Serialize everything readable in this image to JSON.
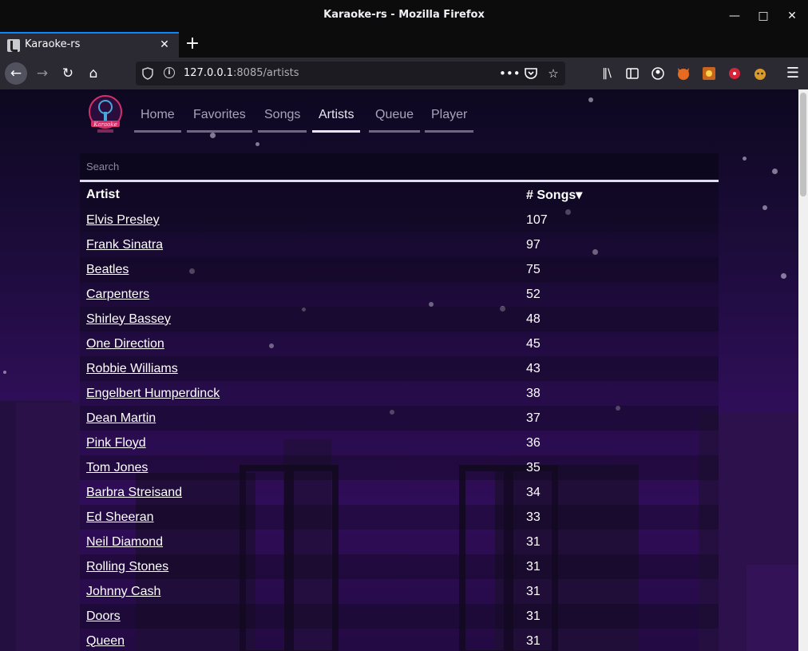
{
  "window": {
    "title": "Karaoke-rs - Mozilla Firefox"
  },
  "tab": {
    "label": "Karaoke-rs"
  },
  "url": {
    "host": "127.0.0.1",
    "rest": ":8085/artists"
  },
  "nav": {
    "logo_text": "Karaoke",
    "links": [
      {
        "label": "Home"
      },
      {
        "label": "Favorites"
      },
      {
        "label": "Songs"
      },
      {
        "label": "Artists"
      },
      {
        "label": "Queue"
      },
      {
        "label": "Player"
      }
    ],
    "active": "Artists"
  },
  "search": {
    "placeholder": "Search"
  },
  "table": {
    "col_artist": "Artist",
    "col_songs": "# Songs",
    "sort_indicator": "▾",
    "rows": [
      {
        "artist": "Elvis Presley",
        "songs": "107"
      },
      {
        "artist": "Frank Sinatra",
        "songs": "97"
      },
      {
        "artist": "Beatles",
        "songs": "75"
      },
      {
        "artist": "Carpenters",
        "songs": "52"
      },
      {
        "artist": "Shirley Bassey",
        "songs": "48"
      },
      {
        "artist": "One Direction",
        "songs": "45"
      },
      {
        "artist": "Robbie Williams",
        "songs": "43"
      },
      {
        "artist": "Engelbert Humperdinck",
        "songs": "38"
      },
      {
        "artist": "Dean Martin",
        "songs": "37"
      },
      {
        "artist": "Pink Floyd",
        "songs": "36"
      },
      {
        "artist": "Tom Jones",
        "songs": "35"
      },
      {
        "artist": "Barbra Streisand",
        "songs": "34"
      },
      {
        "artist": "Ed Sheeran",
        "songs": "33"
      },
      {
        "artist": "Neil Diamond",
        "songs": "31"
      },
      {
        "artist": "Rolling Stones",
        "songs": "31"
      },
      {
        "artist": "Johnny Cash",
        "songs": "31"
      },
      {
        "artist": "Doors",
        "songs": "31"
      },
      {
        "artist": "Queen",
        "songs": "31"
      }
    ]
  },
  "colors": {
    "accent_tab": "#0a84ff",
    "bg_top": "#0d0820",
    "bg_bottom": "#3a0f6b"
  }
}
